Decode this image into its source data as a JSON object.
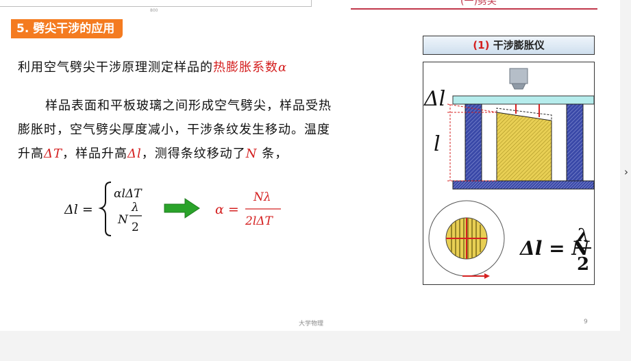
{
  "ruler": {
    "tick": "800"
  },
  "header": {
    "partial": "(一)劈尖"
  },
  "section": {
    "title": "5. 劈尖干涉的应用"
  },
  "intro": {
    "text": "利用空气劈尖干涉原理测定样品的",
    "highlight": "热膨胀系数",
    "symbol": "α"
  },
  "body": {
    "line1": "样品表面和平板玻璃之间形成空气劈尖，样品受热",
    "line2": "膨胀时，空气劈尖厚度减小，干涉条纹发生移动。温度",
    "line3_a": "升高",
    "dT": "ΔT",
    "line3_b": "，样品升高",
    "dl": "Δl",
    "line3_c": "，测得条纹移动了",
    "N": "N",
    "line3_d": " 条，"
  },
  "formula": {
    "lhs": "Δl =",
    "case1": "αlΔT",
    "case2_n": "N",
    "lambda": "λ",
    "two": "2",
    "result_lhs": "α =",
    "result_num": "Nλ",
    "result_den": "2lΔT"
  },
  "panel": {
    "title_num": "(1)",
    "title_text": "干涉膨胀仪",
    "dl_label": "Δl",
    "l_label": "l",
    "eq_lhs": "Δl = N",
    "eq_num": "λ",
    "eq_den": "2"
  },
  "footer": {
    "center": "大学物理",
    "page": "9"
  },
  "nav": {
    "next": "›"
  },
  "colors": {
    "accent": "#f47b20",
    "highlight": "#d42020",
    "pillar": "#3a49a8",
    "sample": "#e8cf54",
    "plate": "#b6ecec"
  }
}
